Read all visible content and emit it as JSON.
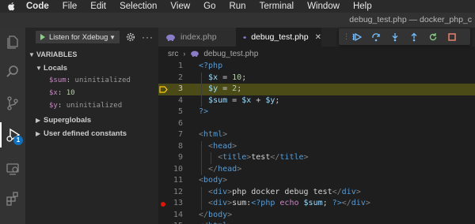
{
  "menubar": {
    "items": [
      "Code",
      "File",
      "Edit",
      "Selection",
      "View",
      "Go",
      "Run",
      "Terminal",
      "Window",
      "Help"
    ]
  },
  "window": {
    "title": "debug_test.php — docker_php_c"
  },
  "activity": {
    "icons": [
      "explorer-icon",
      "search-icon",
      "source-control-icon",
      "run-debug-icon",
      "remote-explorer-icon",
      "extensions-icon"
    ],
    "debug_badge": "1"
  },
  "sidebar": {
    "launch_config": "Listen for Xdebug",
    "variables_title": "VARIABLES",
    "locals_label": "Locals",
    "locals": [
      {
        "name": "$sum",
        "value": "uninitialized",
        "kind": "text"
      },
      {
        "name": "$x",
        "value": "10",
        "kind": "num"
      },
      {
        "name": "$y",
        "value": "uninitialized",
        "kind": "text"
      }
    ],
    "scopes": [
      "Superglobals",
      "User defined constants"
    ]
  },
  "tabs": [
    {
      "label": "index.php",
      "active": false
    },
    {
      "label": "debug_test.php",
      "active": true
    }
  ],
  "breadcrumb": {
    "folder": "src",
    "file": "debug_test.php"
  },
  "debug_toolbar": [
    "continue-icon",
    "step-over-icon",
    "step-into-icon",
    "step-out-icon",
    "restart-icon",
    "stop-icon"
  ],
  "editor": {
    "current_line": 3,
    "breakpoint_lines": [
      13
    ],
    "lines": [
      {
        "n": "1",
        "t": "<?php"
      },
      {
        "n": "2",
        "t": "  $x = 10;"
      },
      {
        "n": "3",
        "t": "  $y = 2;"
      },
      {
        "n": "4",
        "t": "  $sum = $x + $y;"
      },
      {
        "n": "5",
        "t": "?>"
      },
      {
        "n": "6",
        "t": ""
      },
      {
        "n": "7",
        "t": "<html>"
      },
      {
        "n": "8",
        "t": "  <head>"
      },
      {
        "n": "9",
        "t": "    <title>test</title>"
      },
      {
        "n": "10",
        "t": "  </head>"
      },
      {
        "n": "11",
        "t": "<body>"
      },
      {
        "n": "12",
        "t": "  <div>php docker debug test</div>"
      },
      {
        "n": "13",
        "t": "  <div>sum:<?php echo $sum; ?></div>"
      },
      {
        "n": "14",
        "t": "</body>"
      },
      {
        "n": "15",
        "t": "</html>"
      }
    ]
  },
  "colors": {
    "accent": "#0e70c0",
    "current_line_bg": "#4b4b18",
    "breakpoint": "#e51400",
    "debug_continue": "#75beff",
    "debug_restart": "#89d185",
    "debug_stop": "#f48771"
  }
}
